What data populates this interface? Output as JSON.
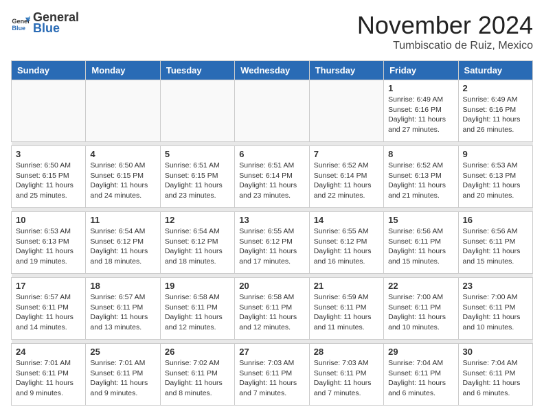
{
  "logo": {
    "general": "General",
    "blue": "Blue"
  },
  "header": {
    "month": "November 2024",
    "location": "Tumbiscatio de Ruiz, Mexico"
  },
  "days_of_week": [
    "Sunday",
    "Monday",
    "Tuesday",
    "Wednesday",
    "Thursday",
    "Friday",
    "Saturday"
  ],
  "weeks": [
    [
      {
        "day": "",
        "info": ""
      },
      {
        "day": "",
        "info": ""
      },
      {
        "day": "",
        "info": ""
      },
      {
        "day": "",
        "info": ""
      },
      {
        "day": "",
        "info": ""
      },
      {
        "day": "1",
        "info": "Sunrise: 6:49 AM\nSunset: 6:16 PM\nDaylight: 11 hours and 27 minutes."
      },
      {
        "day": "2",
        "info": "Sunrise: 6:49 AM\nSunset: 6:16 PM\nDaylight: 11 hours and 26 minutes."
      }
    ],
    [
      {
        "day": "3",
        "info": "Sunrise: 6:50 AM\nSunset: 6:15 PM\nDaylight: 11 hours and 25 minutes."
      },
      {
        "day": "4",
        "info": "Sunrise: 6:50 AM\nSunset: 6:15 PM\nDaylight: 11 hours and 24 minutes."
      },
      {
        "day": "5",
        "info": "Sunrise: 6:51 AM\nSunset: 6:15 PM\nDaylight: 11 hours and 23 minutes."
      },
      {
        "day": "6",
        "info": "Sunrise: 6:51 AM\nSunset: 6:14 PM\nDaylight: 11 hours and 23 minutes."
      },
      {
        "day": "7",
        "info": "Sunrise: 6:52 AM\nSunset: 6:14 PM\nDaylight: 11 hours and 22 minutes."
      },
      {
        "day": "8",
        "info": "Sunrise: 6:52 AM\nSunset: 6:13 PM\nDaylight: 11 hours and 21 minutes."
      },
      {
        "day": "9",
        "info": "Sunrise: 6:53 AM\nSunset: 6:13 PM\nDaylight: 11 hours and 20 minutes."
      }
    ],
    [
      {
        "day": "10",
        "info": "Sunrise: 6:53 AM\nSunset: 6:13 PM\nDaylight: 11 hours and 19 minutes."
      },
      {
        "day": "11",
        "info": "Sunrise: 6:54 AM\nSunset: 6:12 PM\nDaylight: 11 hours and 18 minutes."
      },
      {
        "day": "12",
        "info": "Sunrise: 6:54 AM\nSunset: 6:12 PM\nDaylight: 11 hours and 18 minutes."
      },
      {
        "day": "13",
        "info": "Sunrise: 6:55 AM\nSunset: 6:12 PM\nDaylight: 11 hours and 17 minutes."
      },
      {
        "day": "14",
        "info": "Sunrise: 6:55 AM\nSunset: 6:12 PM\nDaylight: 11 hours and 16 minutes."
      },
      {
        "day": "15",
        "info": "Sunrise: 6:56 AM\nSunset: 6:11 PM\nDaylight: 11 hours and 15 minutes."
      },
      {
        "day": "16",
        "info": "Sunrise: 6:56 AM\nSunset: 6:11 PM\nDaylight: 11 hours and 15 minutes."
      }
    ],
    [
      {
        "day": "17",
        "info": "Sunrise: 6:57 AM\nSunset: 6:11 PM\nDaylight: 11 hours and 14 minutes."
      },
      {
        "day": "18",
        "info": "Sunrise: 6:57 AM\nSunset: 6:11 PM\nDaylight: 11 hours and 13 minutes."
      },
      {
        "day": "19",
        "info": "Sunrise: 6:58 AM\nSunset: 6:11 PM\nDaylight: 11 hours and 12 minutes."
      },
      {
        "day": "20",
        "info": "Sunrise: 6:58 AM\nSunset: 6:11 PM\nDaylight: 11 hours and 12 minutes."
      },
      {
        "day": "21",
        "info": "Sunrise: 6:59 AM\nSunset: 6:11 PM\nDaylight: 11 hours and 11 minutes."
      },
      {
        "day": "22",
        "info": "Sunrise: 7:00 AM\nSunset: 6:11 PM\nDaylight: 11 hours and 10 minutes."
      },
      {
        "day": "23",
        "info": "Sunrise: 7:00 AM\nSunset: 6:11 PM\nDaylight: 11 hours and 10 minutes."
      }
    ],
    [
      {
        "day": "24",
        "info": "Sunrise: 7:01 AM\nSunset: 6:11 PM\nDaylight: 11 hours and 9 minutes."
      },
      {
        "day": "25",
        "info": "Sunrise: 7:01 AM\nSunset: 6:11 PM\nDaylight: 11 hours and 9 minutes."
      },
      {
        "day": "26",
        "info": "Sunrise: 7:02 AM\nSunset: 6:11 PM\nDaylight: 11 hours and 8 minutes."
      },
      {
        "day": "27",
        "info": "Sunrise: 7:03 AM\nSunset: 6:11 PM\nDaylight: 11 hours and 7 minutes."
      },
      {
        "day": "28",
        "info": "Sunrise: 7:03 AM\nSunset: 6:11 PM\nDaylight: 11 hours and 7 minutes."
      },
      {
        "day": "29",
        "info": "Sunrise: 7:04 AM\nSunset: 6:11 PM\nDaylight: 11 hours and 6 minutes."
      },
      {
        "day": "30",
        "info": "Sunrise: 7:04 AM\nSunset: 6:11 PM\nDaylight: 11 hours and 6 minutes."
      }
    ]
  ]
}
